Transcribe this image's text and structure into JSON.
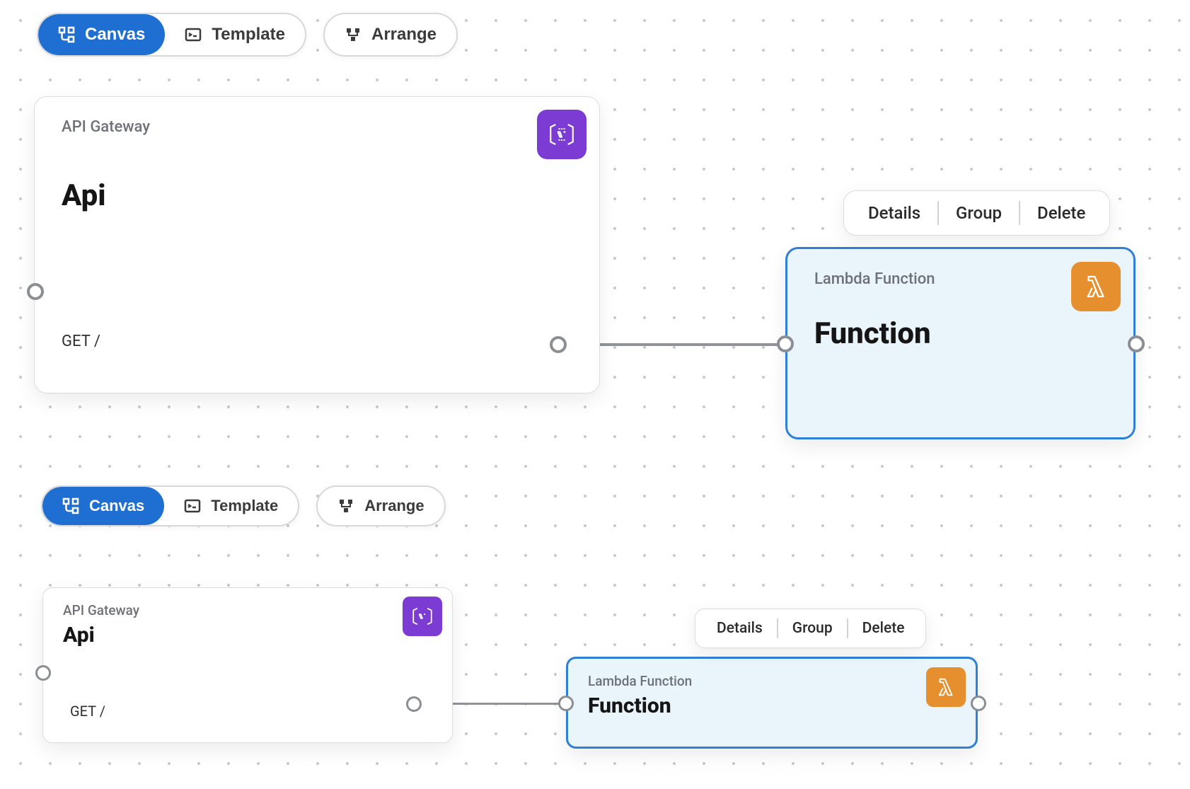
{
  "toolbar": {
    "canvas_label": "Canvas",
    "template_label": "Template",
    "arrange_label": "Arrange"
  },
  "context_menu": {
    "details_label": "Details",
    "group_label": "Group",
    "delete_label": "Delete"
  },
  "panels": [
    {
      "nodes": {
        "api": {
          "type_label": "API Gateway",
          "name": "Api",
          "endpoint": "GET /"
        },
        "function": {
          "type_label": "Lambda Function",
          "name": "Function"
        }
      }
    },
    {
      "nodes": {
        "api": {
          "type_label": "API Gateway",
          "name": "Api",
          "endpoint": "GET /"
        },
        "function": {
          "type_label": "Lambda Function",
          "name": "Function"
        }
      }
    }
  ],
  "colors": {
    "accent_blue": "#1f6fd3",
    "api_purple": "#7c3bd3",
    "lambda_orange": "#e58f2f",
    "selected_bg": "#e9f4fb"
  },
  "icons": {
    "canvas_icon": "canvas-icon",
    "template_icon": "template-icon",
    "arrange_icon": "arrange-icon",
    "api_gateway_icon": "api-gateway-icon",
    "lambda_icon": "lambda-icon"
  }
}
